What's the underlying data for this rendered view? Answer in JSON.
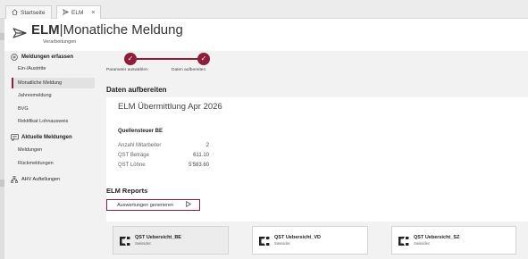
{
  "tabs": [
    {
      "label": "Startseite",
      "icon": "home-icon"
    },
    {
      "label": "ELM",
      "icon": "send-icon",
      "close": "×"
    }
  ],
  "app": {
    "logo_icon": "send-icon",
    "title_bold": "ELM",
    "title_separator": "|",
    "title_rest": "Monatliche Meldung",
    "subtitle": "Verarbeitungen"
  },
  "sidebar": {
    "section_erfassen": {
      "label": "Meldungen erfassen",
      "icon": "plus-circle-icon"
    },
    "items_erfassen": [
      {
        "label": "Ein-/Austritte"
      },
      {
        "label": "Monatliche Meldung",
        "active": true
      },
      {
        "label": "Jahresmeldung"
      },
      {
        "label": "BVG"
      },
      {
        "label": "Rektifikat Lohnausweis"
      }
    ],
    "section_aktuelle": {
      "label": "Aktuelle Meldungen",
      "icon": "message-icon"
    },
    "items_aktuelle": [
      {
        "label": "Meldungen"
      },
      {
        "label": "Rückmeldungen"
      }
    ],
    "section_ahv": {
      "label": "AHV Auftellungen",
      "icon": "hierarchy-icon"
    }
  },
  "stepper": {
    "steps": [
      {
        "label": "Parameter auswählen",
        "done": true
      },
      {
        "label": "Daten aufbereiten",
        "done": true
      }
    ],
    "check": "✓"
  },
  "main": {
    "section_title": "Daten aufbereiten",
    "card_title": "ELM Übermittlung Apr 2026",
    "card_subtitle": "Quellensteuer BE",
    "rows": [
      {
        "label": "Anzahl Mitarbeiter",
        "value": "2"
      },
      {
        "label": "QST Beträge",
        "value": "611.10"
      },
      {
        "label": "QST Löhne",
        "value": "5'583.60"
      }
    ]
  },
  "reports": {
    "title": "ELM Reports",
    "generate_button": "Auswertungen generieren",
    "tiles": [
      {
        "name": "QST Uebersicht_BE",
        "sub": "Swissdec",
        "selected": true
      },
      {
        "name": "QST Uebersicht_VD",
        "sub": "Swissdec"
      },
      {
        "name": "QST Uebersicht_SZ",
        "sub": "Swissdec"
      }
    ]
  },
  "colors": {
    "accent": "#8e1e3c",
    "background": "#f2f2f2",
    "card": "#ffffff"
  }
}
